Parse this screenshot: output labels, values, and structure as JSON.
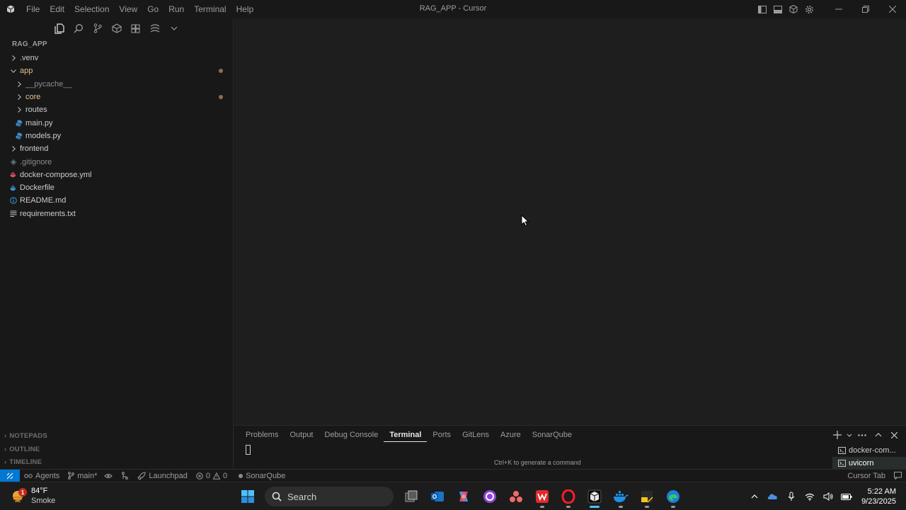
{
  "window": {
    "title": "RAG_APP - Cursor",
    "menu": [
      "File",
      "Edit",
      "Selection",
      "View",
      "Go",
      "Run",
      "Terminal",
      "Help"
    ]
  },
  "explorer": {
    "root": "RAG_APP",
    "items": [
      {
        "label": ".venv",
        "kind": "folder",
        "expanded": false,
        "depth": 0,
        "color": "#cccccc"
      },
      {
        "label": "app",
        "kind": "folder",
        "expanded": true,
        "depth": 0,
        "color": "#e2c08d",
        "modified": true
      },
      {
        "label": "__pycache__",
        "kind": "folder",
        "expanded": false,
        "depth": 1,
        "color": "#8b8b8b"
      },
      {
        "label": "core",
        "kind": "folder",
        "expanded": false,
        "depth": 1,
        "color": "#e2c08d",
        "modified": true
      },
      {
        "label": "routes",
        "kind": "folder",
        "expanded": false,
        "depth": 1,
        "color": "#cccccc"
      },
      {
        "label": "main.py",
        "kind": "python",
        "depth": 1,
        "color": "#cccccc"
      },
      {
        "label": "models.py",
        "kind": "python",
        "depth": 1,
        "color": "#cccccc"
      },
      {
        "label": "frontend",
        "kind": "folder",
        "expanded": false,
        "depth": 0,
        "color": "#cccccc"
      },
      {
        "label": ".gitignore",
        "kind": "git",
        "depth": 0,
        "color": "#8b8b8b"
      },
      {
        "label": "docker-compose.yml",
        "kind": "docker-compose",
        "depth": 0,
        "color": "#cccccc"
      },
      {
        "label": "Dockerfile",
        "kind": "docker",
        "depth": 0,
        "color": "#cccccc"
      },
      {
        "label": "README.md",
        "kind": "info",
        "depth": 0,
        "color": "#cccccc"
      },
      {
        "label": "requirements.txt",
        "kind": "text",
        "depth": 0,
        "color": "#cccccc"
      }
    ],
    "sections": [
      "NOTEPADS",
      "OUTLINE",
      "TIMELINE"
    ]
  },
  "panel": {
    "tabs": [
      "Problems",
      "Output",
      "Debug Console",
      "Terminal",
      "Ports",
      "GitLens",
      "Azure",
      "SonarQube"
    ],
    "active_tab": "Terminal",
    "hint": "Ctrl+K to generate a command",
    "terminals": [
      "docker-com...",
      "uvicorn"
    ],
    "active_terminal": "uvicorn"
  },
  "statusbar": {
    "agents": "Agents",
    "branch": "main*",
    "launchpad": "Launchpad",
    "errors": "0",
    "warnings": "0",
    "sonarqube": "SonarQube",
    "cursor_tab": "Cursor Tab"
  },
  "taskbar": {
    "weather_temp": "84°F",
    "weather_desc": "Smoke",
    "weather_badge": "1",
    "search_label": "Search",
    "time": "5:22 AM",
    "date": "9/23/2025"
  },
  "colors": {
    "accent": "#0078d4",
    "modified_folder": "#e2c08d",
    "modified_dot": "#8a7246"
  }
}
